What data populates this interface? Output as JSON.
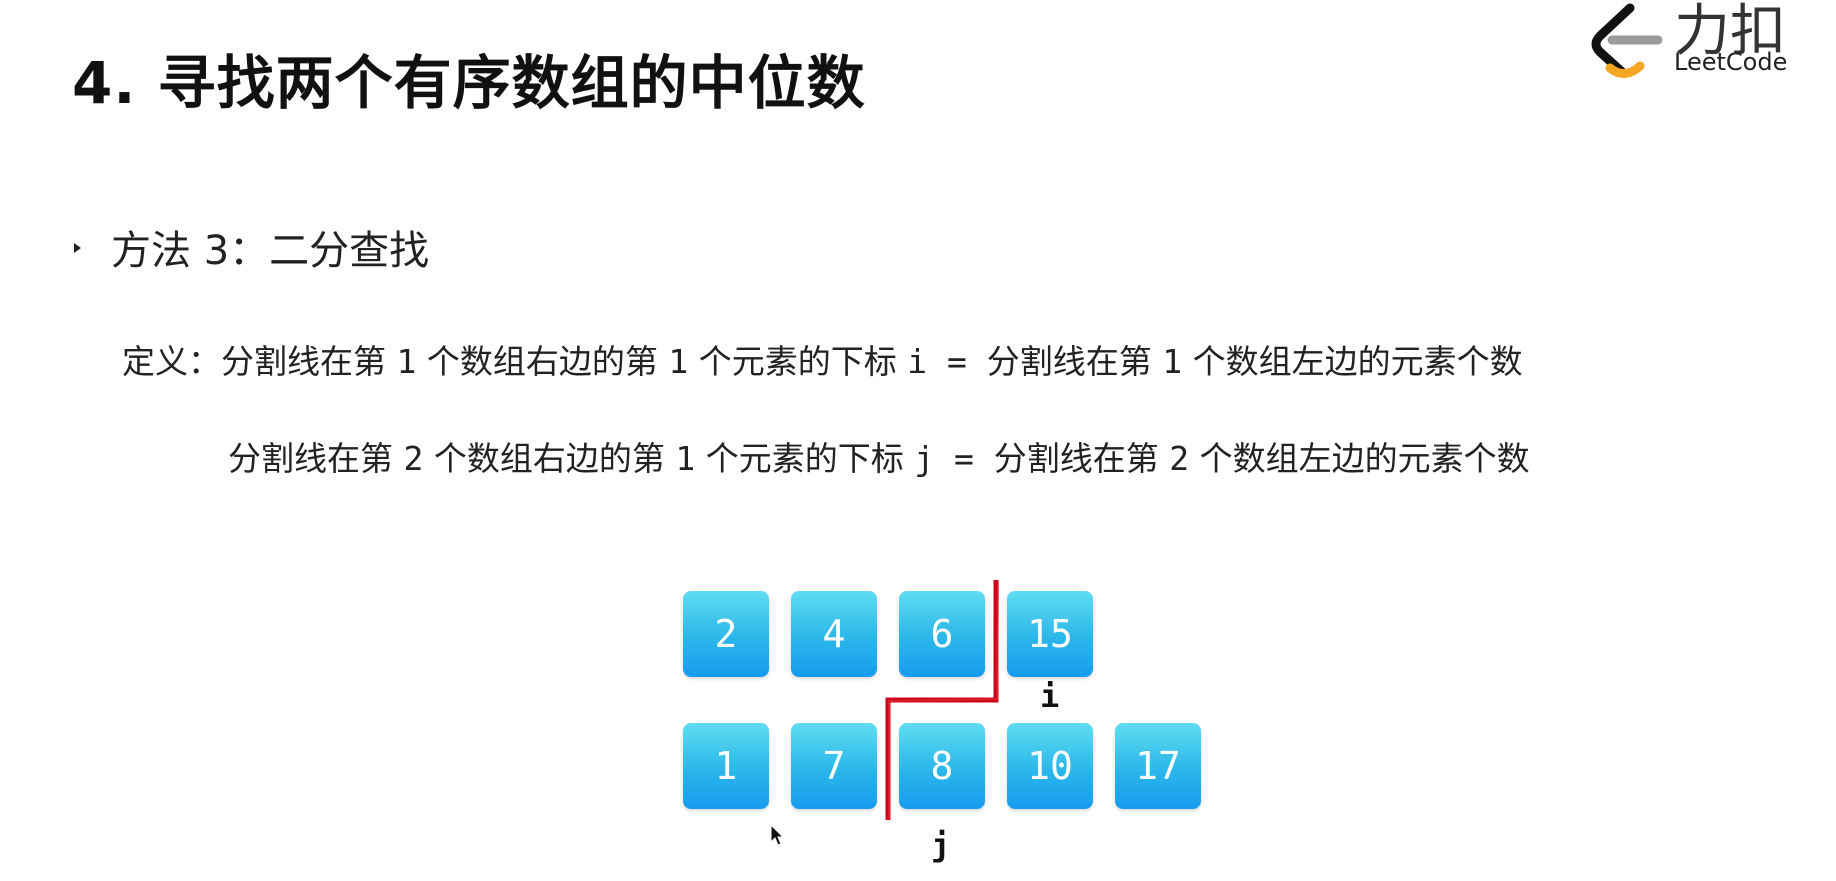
{
  "slide": {
    "title": "4. 寻找两个有序数组的中位数",
    "logo": {
      "cn_text": "力扣",
      "en_text": "LeetCode",
      "accent_colors": [
        "#111111",
        "#f5a623",
        "#9b9b9b"
      ]
    },
    "bullet": {
      "icon": "triangle-bullet-icon",
      "text": "方法 3：二分查找"
    },
    "definition": {
      "line1_prefix": "定义：分割线在第 ",
      "line1_n": "1",
      "line1_mid": " 个数组右边的第 ",
      "line1_k": "1",
      "line1_mid2": " 个元素的下标 ",
      "line1_var": "i",
      "line1_eq": " = ",
      "line1_rest": "分割线在第 ",
      "line1_n2": "1",
      "line1_tail": " 个数组左边的元素个数",
      "line2_prefix": "分割线在第 ",
      "line2_n": "2",
      "line2_mid": " 个数组右边的第 ",
      "line2_k": "1",
      "line2_mid2": " 个元素的下标 ",
      "line2_var": "j",
      "line2_eq": " = ",
      "line2_rest": "分割线在第 ",
      "line2_n2": "2",
      "line2_tail": " 个数组左边的元素个数"
    },
    "diagram": {
      "array1": [
        "2",
        "4",
        "6",
        "15"
      ],
      "array2": [
        "1",
        "7",
        "8",
        "10",
        "17"
      ],
      "index_i_label": "i",
      "index_j_label": "j",
      "partition_line_color": "#d0021b",
      "box_color_top": "#5fdcf1",
      "box_color_bottom": "#159cf0"
    }
  }
}
